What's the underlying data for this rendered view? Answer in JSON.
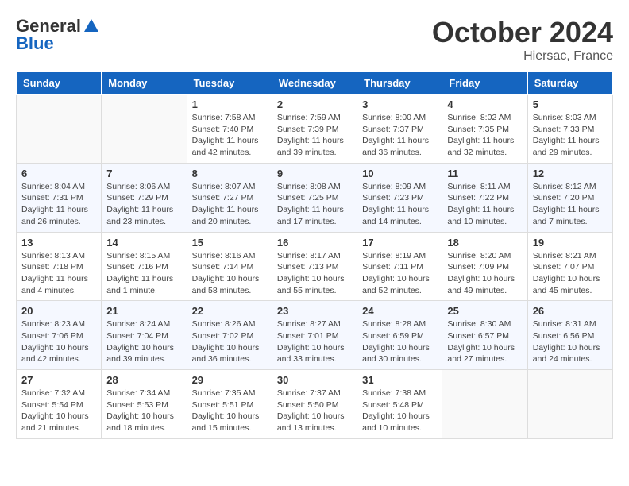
{
  "header": {
    "logo_general": "General",
    "logo_blue": "Blue",
    "month": "October 2024",
    "location": "Hiersac, France"
  },
  "weekdays": [
    "Sunday",
    "Monday",
    "Tuesday",
    "Wednesday",
    "Thursday",
    "Friday",
    "Saturday"
  ],
  "weeks": [
    [
      {
        "day": "",
        "sunrise": "",
        "sunset": "",
        "daylight": ""
      },
      {
        "day": "",
        "sunrise": "",
        "sunset": "",
        "daylight": ""
      },
      {
        "day": "1",
        "sunrise": "Sunrise: 7:58 AM",
        "sunset": "Sunset: 7:40 PM",
        "daylight": "Daylight: 11 hours and 42 minutes."
      },
      {
        "day": "2",
        "sunrise": "Sunrise: 7:59 AM",
        "sunset": "Sunset: 7:39 PM",
        "daylight": "Daylight: 11 hours and 39 minutes."
      },
      {
        "day": "3",
        "sunrise": "Sunrise: 8:00 AM",
        "sunset": "Sunset: 7:37 PM",
        "daylight": "Daylight: 11 hours and 36 minutes."
      },
      {
        "day": "4",
        "sunrise": "Sunrise: 8:02 AM",
        "sunset": "Sunset: 7:35 PM",
        "daylight": "Daylight: 11 hours and 32 minutes."
      },
      {
        "day": "5",
        "sunrise": "Sunrise: 8:03 AM",
        "sunset": "Sunset: 7:33 PM",
        "daylight": "Daylight: 11 hours and 29 minutes."
      }
    ],
    [
      {
        "day": "6",
        "sunrise": "Sunrise: 8:04 AM",
        "sunset": "Sunset: 7:31 PM",
        "daylight": "Daylight: 11 hours and 26 minutes."
      },
      {
        "day": "7",
        "sunrise": "Sunrise: 8:06 AM",
        "sunset": "Sunset: 7:29 PM",
        "daylight": "Daylight: 11 hours and 23 minutes."
      },
      {
        "day": "8",
        "sunrise": "Sunrise: 8:07 AM",
        "sunset": "Sunset: 7:27 PM",
        "daylight": "Daylight: 11 hours and 20 minutes."
      },
      {
        "day": "9",
        "sunrise": "Sunrise: 8:08 AM",
        "sunset": "Sunset: 7:25 PM",
        "daylight": "Daylight: 11 hours and 17 minutes."
      },
      {
        "day": "10",
        "sunrise": "Sunrise: 8:09 AM",
        "sunset": "Sunset: 7:23 PM",
        "daylight": "Daylight: 11 hours and 14 minutes."
      },
      {
        "day": "11",
        "sunrise": "Sunrise: 8:11 AM",
        "sunset": "Sunset: 7:22 PM",
        "daylight": "Daylight: 11 hours and 10 minutes."
      },
      {
        "day": "12",
        "sunrise": "Sunrise: 8:12 AM",
        "sunset": "Sunset: 7:20 PM",
        "daylight": "Daylight: 11 hours and 7 minutes."
      }
    ],
    [
      {
        "day": "13",
        "sunrise": "Sunrise: 8:13 AM",
        "sunset": "Sunset: 7:18 PM",
        "daylight": "Daylight: 11 hours and 4 minutes."
      },
      {
        "day": "14",
        "sunrise": "Sunrise: 8:15 AM",
        "sunset": "Sunset: 7:16 PM",
        "daylight": "Daylight: 11 hours and 1 minute."
      },
      {
        "day": "15",
        "sunrise": "Sunrise: 8:16 AM",
        "sunset": "Sunset: 7:14 PM",
        "daylight": "Daylight: 10 hours and 58 minutes."
      },
      {
        "day": "16",
        "sunrise": "Sunrise: 8:17 AM",
        "sunset": "Sunset: 7:13 PM",
        "daylight": "Daylight: 10 hours and 55 minutes."
      },
      {
        "day": "17",
        "sunrise": "Sunrise: 8:19 AM",
        "sunset": "Sunset: 7:11 PM",
        "daylight": "Daylight: 10 hours and 52 minutes."
      },
      {
        "day": "18",
        "sunrise": "Sunrise: 8:20 AM",
        "sunset": "Sunset: 7:09 PM",
        "daylight": "Daylight: 10 hours and 49 minutes."
      },
      {
        "day": "19",
        "sunrise": "Sunrise: 8:21 AM",
        "sunset": "Sunset: 7:07 PM",
        "daylight": "Daylight: 10 hours and 45 minutes."
      }
    ],
    [
      {
        "day": "20",
        "sunrise": "Sunrise: 8:23 AM",
        "sunset": "Sunset: 7:06 PM",
        "daylight": "Daylight: 10 hours and 42 minutes."
      },
      {
        "day": "21",
        "sunrise": "Sunrise: 8:24 AM",
        "sunset": "Sunset: 7:04 PM",
        "daylight": "Daylight: 10 hours and 39 minutes."
      },
      {
        "day": "22",
        "sunrise": "Sunrise: 8:26 AM",
        "sunset": "Sunset: 7:02 PM",
        "daylight": "Daylight: 10 hours and 36 minutes."
      },
      {
        "day": "23",
        "sunrise": "Sunrise: 8:27 AM",
        "sunset": "Sunset: 7:01 PM",
        "daylight": "Daylight: 10 hours and 33 minutes."
      },
      {
        "day": "24",
        "sunrise": "Sunrise: 8:28 AM",
        "sunset": "Sunset: 6:59 PM",
        "daylight": "Daylight: 10 hours and 30 minutes."
      },
      {
        "day": "25",
        "sunrise": "Sunrise: 8:30 AM",
        "sunset": "Sunset: 6:57 PM",
        "daylight": "Daylight: 10 hours and 27 minutes."
      },
      {
        "day": "26",
        "sunrise": "Sunrise: 8:31 AM",
        "sunset": "Sunset: 6:56 PM",
        "daylight": "Daylight: 10 hours and 24 minutes."
      }
    ],
    [
      {
        "day": "27",
        "sunrise": "Sunrise: 7:32 AM",
        "sunset": "Sunset: 5:54 PM",
        "daylight": "Daylight: 10 hours and 21 minutes."
      },
      {
        "day": "28",
        "sunrise": "Sunrise: 7:34 AM",
        "sunset": "Sunset: 5:53 PM",
        "daylight": "Daylight: 10 hours and 18 minutes."
      },
      {
        "day": "29",
        "sunrise": "Sunrise: 7:35 AM",
        "sunset": "Sunset: 5:51 PM",
        "daylight": "Daylight: 10 hours and 15 minutes."
      },
      {
        "day": "30",
        "sunrise": "Sunrise: 7:37 AM",
        "sunset": "Sunset: 5:50 PM",
        "daylight": "Daylight: 10 hours and 13 minutes."
      },
      {
        "day": "31",
        "sunrise": "Sunrise: 7:38 AM",
        "sunset": "Sunset: 5:48 PM",
        "daylight": "Daylight: 10 hours and 10 minutes."
      },
      {
        "day": "",
        "sunrise": "",
        "sunset": "",
        "daylight": ""
      },
      {
        "day": "",
        "sunrise": "",
        "sunset": "",
        "daylight": ""
      }
    ]
  ]
}
